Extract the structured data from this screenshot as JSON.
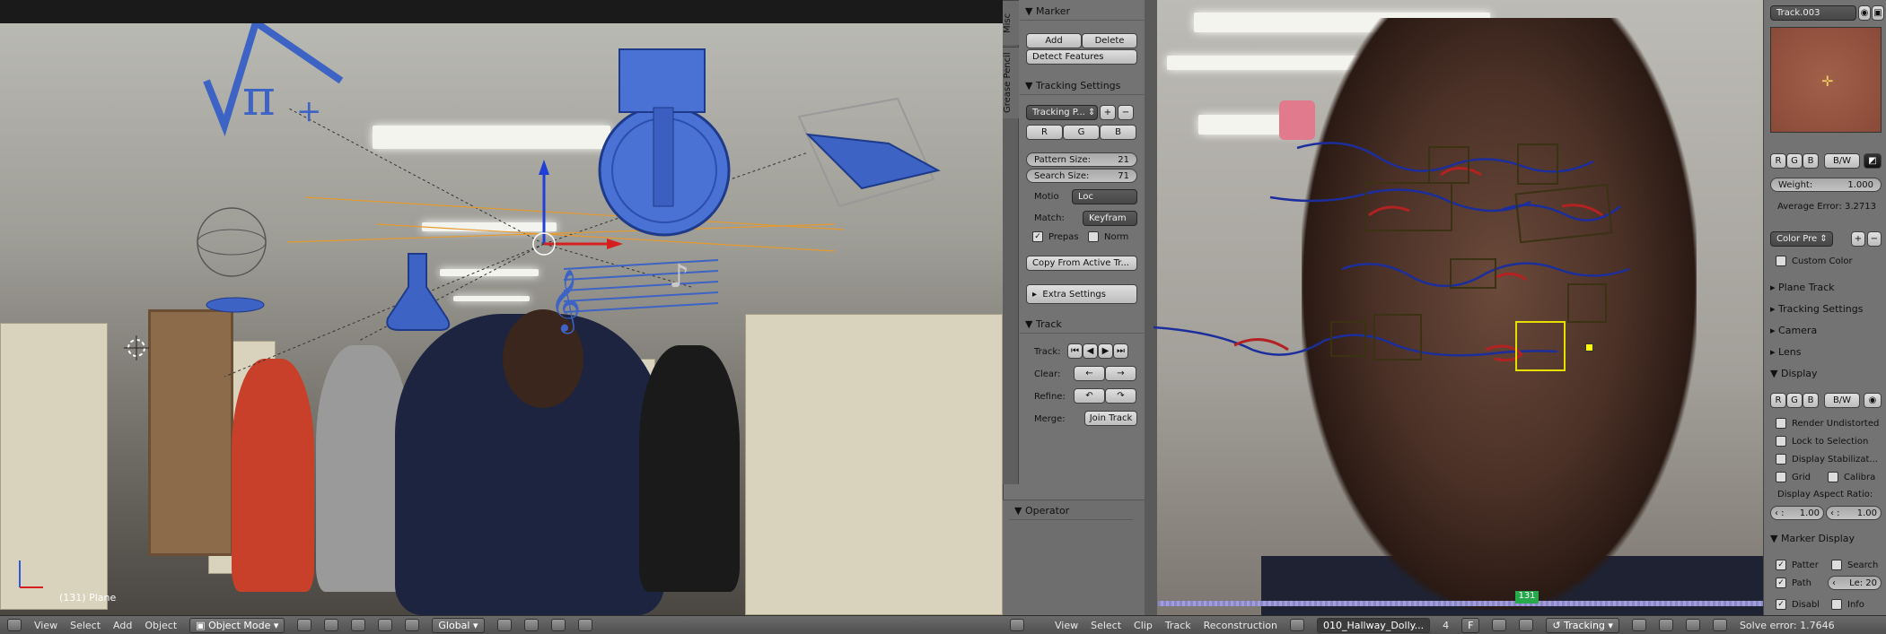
{
  "viewport": {
    "status_label": "(131) Plane"
  },
  "viewport_header": {
    "view": "View",
    "select": "Select",
    "add": "Add",
    "object": "Object",
    "mode": "Object Mode",
    "orientation": "Global"
  },
  "tool_shelf": {
    "tabs": [
      "Misc",
      "Grease Pencil"
    ],
    "marker": {
      "title": "Marker",
      "add": "Add",
      "delete": "Delete",
      "detect_features": "Detect Features"
    },
    "tracking_settings": {
      "title": "Tracking Settings",
      "preset": "Tracking P...",
      "channels": [
        "R",
        "G",
        "B"
      ],
      "pattern_size_label": "Pattern Size:",
      "pattern_size": "21",
      "search_size_label": "Search Size:",
      "search_size": "71",
      "motion_label": "Motio",
      "motion_value": "Loc",
      "match_label": "Match:",
      "match_value": "Keyfram",
      "prepass": "Prepas",
      "normalize": "Norm",
      "copy_from_active": "Copy From Active Tr...",
      "extra_settings": "Extra Settings"
    },
    "track": {
      "title": "Track",
      "track_label": "Track:",
      "clear_label": "Clear:",
      "refine_label": "Refine:",
      "merge_label": "Merge:",
      "join_track": "Join Track"
    },
    "operator": {
      "title": "Operator"
    }
  },
  "clip_editor": {
    "frame": "131"
  },
  "clip_header": {
    "view": "View",
    "select": "Select",
    "clip": "Clip",
    "track": "Track",
    "reconstruction": "Reconstruction",
    "clip_name": "010_Hallway_Dolly...",
    "users": "4",
    "fake_user": "F",
    "mode": "Tracking",
    "solve_error": "Solve error: 1.7646"
  },
  "properties": {
    "track_name": "Track.003",
    "channels": [
      "R",
      "G",
      "B"
    ],
    "bw": "B/W",
    "weight_label": "Weight:",
    "weight_value": "1.000",
    "average_error": "Average Error: 3.2713",
    "color_preset": "Color Pre",
    "custom_color": "Custom Color",
    "plane_track": "Plane Track",
    "tracking_settings": "Tracking Settings",
    "camera": "Camera",
    "lens": "Lens",
    "display": {
      "title": "Display",
      "bw": "B/W",
      "render_undistorted": "Render Undistorted",
      "lock_to_selection": "Lock to Selection",
      "display_stabilization": "Display Stabilizat...",
      "grid": "Grid",
      "calibration": "Calibra",
      "aspect_ratio_label": "Display Aspect Ratio:",
      "aspect_x": "1.00",
      "aspect_y": "1.00"
    },
    "marker_display": {
      "title": "Marker Display",
      "pattern": "Patter",
      "search": "Search",
      "path": "Path",
      "path_length": "Le: 20",
      "disabled": "Disabl",
      "info": "Info"
    }
  },
  "colors": {
    "panel_bg": "#737373",
    "header_bg": "#5a5a5a",
    "frame_badge": "#27a84a",
    "selected_track": "#e6e000",
    "path_red": "#b22222",
    "path_blue": "#1b2e9c"
  }
}
